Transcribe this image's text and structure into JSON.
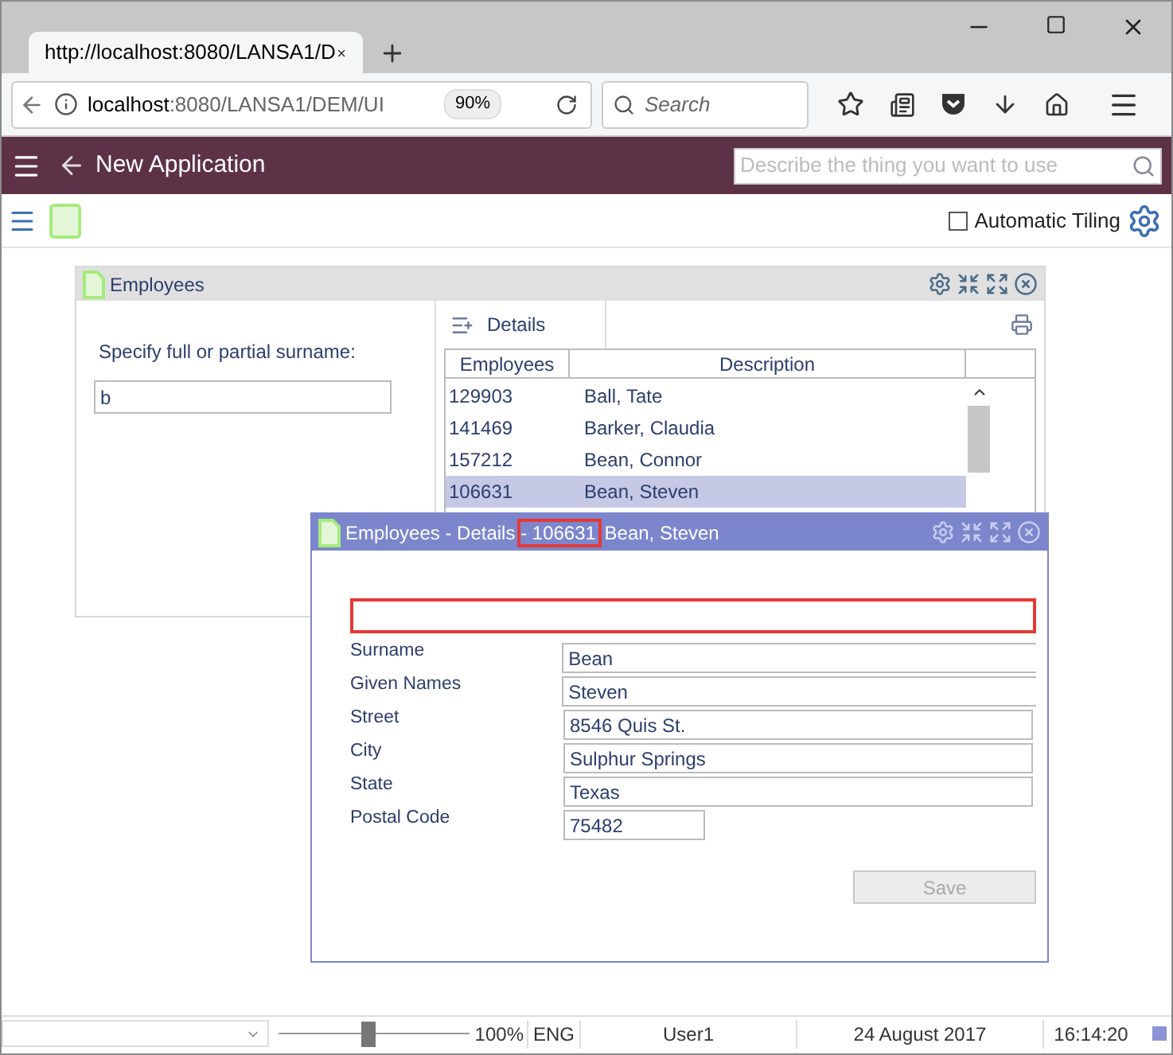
{
  "browser": {
    "tab_title": "http://localhost:8080/LANSA1/D",
    "url_host": "localhost",
    "url_rest": ":8080/LANSA1/DEM/UI",
    "zoom": "90%",
    "search_placeholder": "Search"
  },
  "app": {
    "title": "New Application",
    "search_placeholder": "Describe the thing you want to use",
    "automatic_tiling": {
      "label": "Automatic Tiling",
      "checked": false
    }
  },
  "employees_window": {
    "title": "Employees",
    "prompt": "Specify full or partial surname:",
    "surname_filter": "b",
    "details_tab": "Details",
    "columns": [
      "Employees",
      "Description"
    ],
    "rows": [
      {
        "id": "129903",
        "name": "Ball, Tate",
        "selected": false
      },
      {
        "id": "141469",
        "name": "Barker, Claudia",
        "selected": false
      },
      {
        "id": "157212",
        "name": "Bean, Connor",
        "selected": false
      },
      {
        "id": "106631",
        "name": "Bean, Steven",
        "selected": true
      }
    ]
  },
  "details_window": {
    "title_prefix": "Employees - Details",
    "title_highlight": "- 106631",
    "title_suffix": "Bean, Steven",
    "fields": [
      {
        "label": "Surname",
        "value": "Bean",
        "kind": "overflow"
      },
      {
        "label": "Given Names",
        "value": "Steven",
        "kind": "overflow"
      },
      {
        "label": "Street",
        "value": "8546 Quis St.",
        "kind": "full"
      },
      {
        "label": "City",
        "value": "Sulphur Springs",
        "kind": "full"
      },
      {
        "label": "State",
        "value": "Texas",
        "kind": "full"
      },
      {
        "label": "Postal Code",
        "value": "75482",
        "kind": "short"
      }
    ],
    "save": {
      "label": "Save",
      "disabled": true
    }
  },
  "status_bar": {
    "zoom_slider": {
      "level": 0.47
    },
    "zoom": "100%",
    "language": "ENG",
    "user": "User1",
    "date": "24 August 2017",
    "time": "16:14:20"
  }
}
